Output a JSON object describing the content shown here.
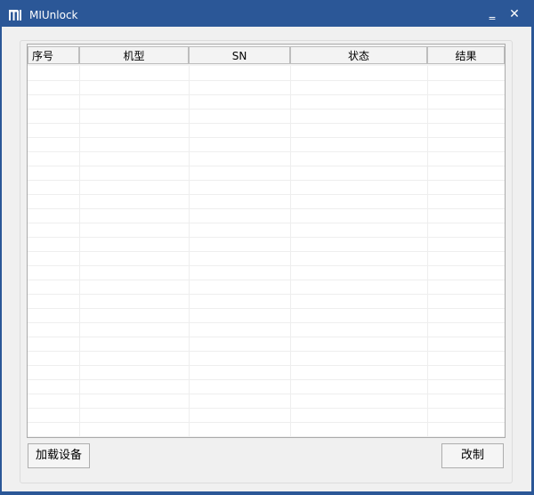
{
  "window": {
    "title": "MIUnlock",
    "minimize_glyph": "‗",
    "close_glyph": "✕",
    "icon": "mi-logo-icon"
  },
  "table": {
    "columns": [
      "序号",
      "机型",
      "SN",
      "状态",
      "结果"
    ],
    "rows": []
  },
  "buttons": {
    "load_devices": "加载设备",
    "modify": "改制"
  },
  "colors": {
    "titlebar": "#2b5797",
    "client_bg": "#f0f0f0",
    "grid": "#eeeeee"
  }
}
